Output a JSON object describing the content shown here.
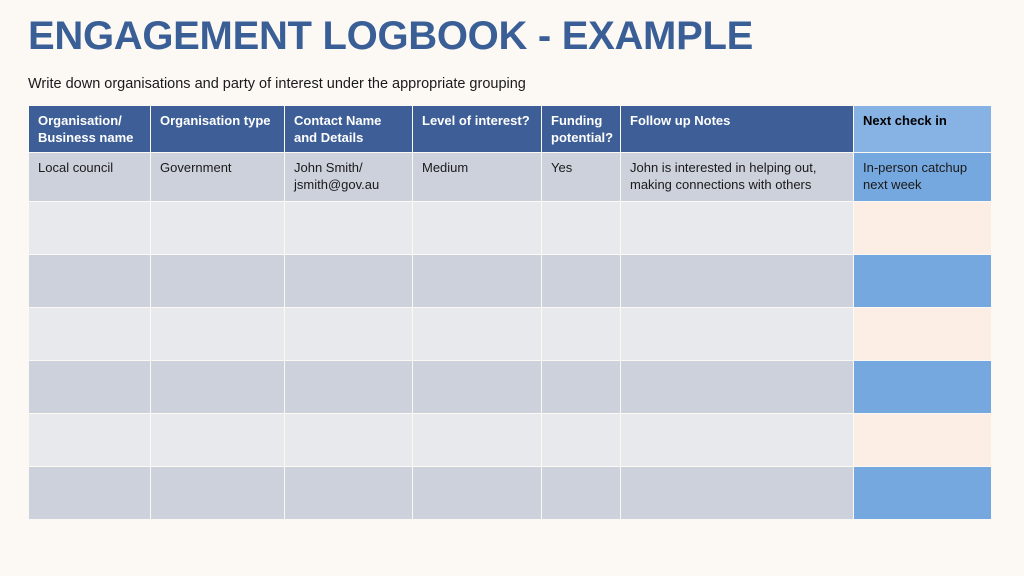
{
  "slide": {
    "title": "ENGAGEMENT LOGBOOK - EXAMPLE",
    "subtitle": "Write down organisations and party of interest under the appropriate grouping",
    "background_color": "#fcf9f5",
    "title_color": "#3a5e96"
  },
  "table": {
    "header_color": "#3d5e96",
    "header_text_color": "#ffffff",
    "highlight_header_color": "#86b3e4",
    "row_dark_color": "#ccd1dc",
    "row_light_color": "#e7e9ed",
    "next_check_blue": "#76a8e0",
    "next_check_peach": "#fdeee5",
    "columns": [
      "Organisation/ Business name",
      "Organisation type",
      "Contact Name and Details",
      "Level of interest?",
      "Funding potential?",
      "Follow up Notes",
      "Next check in"
    ],
    "headers": {
      "organisation": "Organisation/ Business name",
      "organisation_line1": "Organisation/",
      "organisation_line2": "Business name",
      "org_type": "Organisation type",
      "contact_line1": "Contact Name",
      "contact_line2": "and Details",
      "level": "Level of interest?",
      "funding_line1": "Funding",
      "funding_line2": "potential?",
      "notes": "Follow up Notes",
      "next_check": "Next check in"
    },
    "rows": [
      {
        "organisation": "Local council",
        "org_type": "Government",
        "contact": "John Smith/ jsmith@gov.au",
        "contact_line1": "John Smith/",
        "contact_line2": "jsmith@gov.au",
        "level": "Medium",
        "funding": "Yes",
        "notes": "John is interested in helping out, making connections with others",
        "notes_line1": "John is interested in helping out,",
        "notes_line2": "making connections with others",
        "next_check": "In-person catchup next week",
        "next_check_line1": "In-person catchup",
        "next_check_line2": "next week"
      },
      {
        "organisation": "",
        "org_type": "",
        "contact_line1": "",
        "contact_line2": "",
        "level": "",
        "funding": "",
        "notes_line1": "",
        "notes_line2": "",
        "next_check_line1": "",
        "next_check_line2": ""
      },
      {
        "organisation": "",
        "org_type": "",
        "contact_line1": "",
        "contact_line2": "",
        "level": "",
        "funding": "",
        "notes_line1": "",
        "notes_line2": "",
        "next_check_line1": "",
        "next_check_line2": ""
      },
      {
        "organisation": "",
        "org_type": "",
        "contact_line1": "",
        "contact_line2": "",
        "level": "",
        "funding": "",
        "notes_line1": "",
        "notes_line2": "",
        "next_check_line1": "",
        "next_check_line2": ""
      },
      {
        "organisation": "",
        "org_type": "",
        "contact_line1": "",
        "contact_line2": "",
        "level": "",
        "funding": "",
        "notes_line1": "",
        "notes_line2": "",
        "next_check_line1": "",
        "next_check_line2": ""
      },
      {
        "organisation": "",
        "org_type": "",
        "contact_line1": "",
        "contact_line2": "",
        "level": "",
        "funding": "",
        "notes_line1": "",
        "notes_line2": "",
        "next_check_line1": "",
        "next_check_line2": ""
      },
      {
        "organisation": "",
        "org_type": "",
        "contact_line1": "",
        "contact_line2": "",
        "level": "",
        "funding": "",
        "notes_line1": "",
        "notes_line2": "",
        "next_check_line1": "",
        "next_check_line2": ""
      }
    ]
  }
}
